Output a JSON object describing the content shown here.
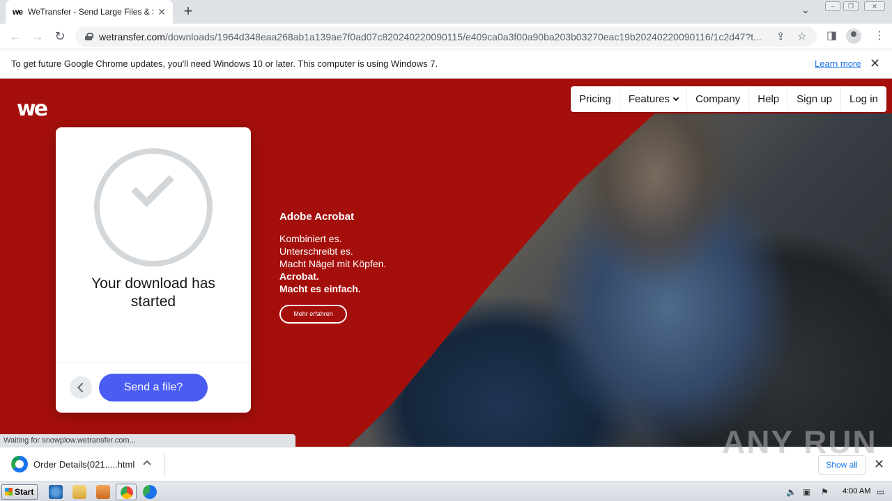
{
  "browser": {
    "tab_favicon": "we",
    "tab_title": "WeTransfer - Send Large Files & Sha",
    "url_host": "wetransfer.com",
    "url_path": "/downloads/1964d348eaa268ab1a139ae7f0ad07c820240220090115/e409ca0a3f00a90ba203b03270eac19b20240220090116/1c2d47?t...",
    "tab_close": "✕",
    "new_tab": "+",
    "back": "←",
    "forward": "→",
    "reload": "↻"
  },
  "infobar": {
    "message": "To get future Google Chrome updates, you'll need Windows 10 or later. This computer is using Windows 7.",
    "link": "Learn more",
    "close": "✕"
  },
  "site": {
    "logo": "we",
    "nav": [
      "Pricing",
      "Features",
      "Company",
      "Help",
      "Sign up",
      "Log in"
    ]
  },
  "card": {
    "title": "Your download has started",
    "send_button": "Send a file?"
  },
  "ad": {
    "brand": "Adobe Acrobat",
    "lines": [
      "Kombiniert es.",
      "Unterschreibt es.",
      "Macht Nägel mit Köpfen."
    ],
    "bold_lines": [
      "Acrobat.",
      "Macht es einfach."
    ],
    "button": "Mehr erfahren"
  },
  "status": "Waiting for snowplow.wetransfer.com...",
  "download": {
    "filename": "Order Details(021.....html",
    "show_all": "Show all",
    "close": "✕"
  },
  "watermark": "ANY RUN",
  "taskbar": {
    "start": "Start",
    "clock": "4:00 AM"
  }
}
